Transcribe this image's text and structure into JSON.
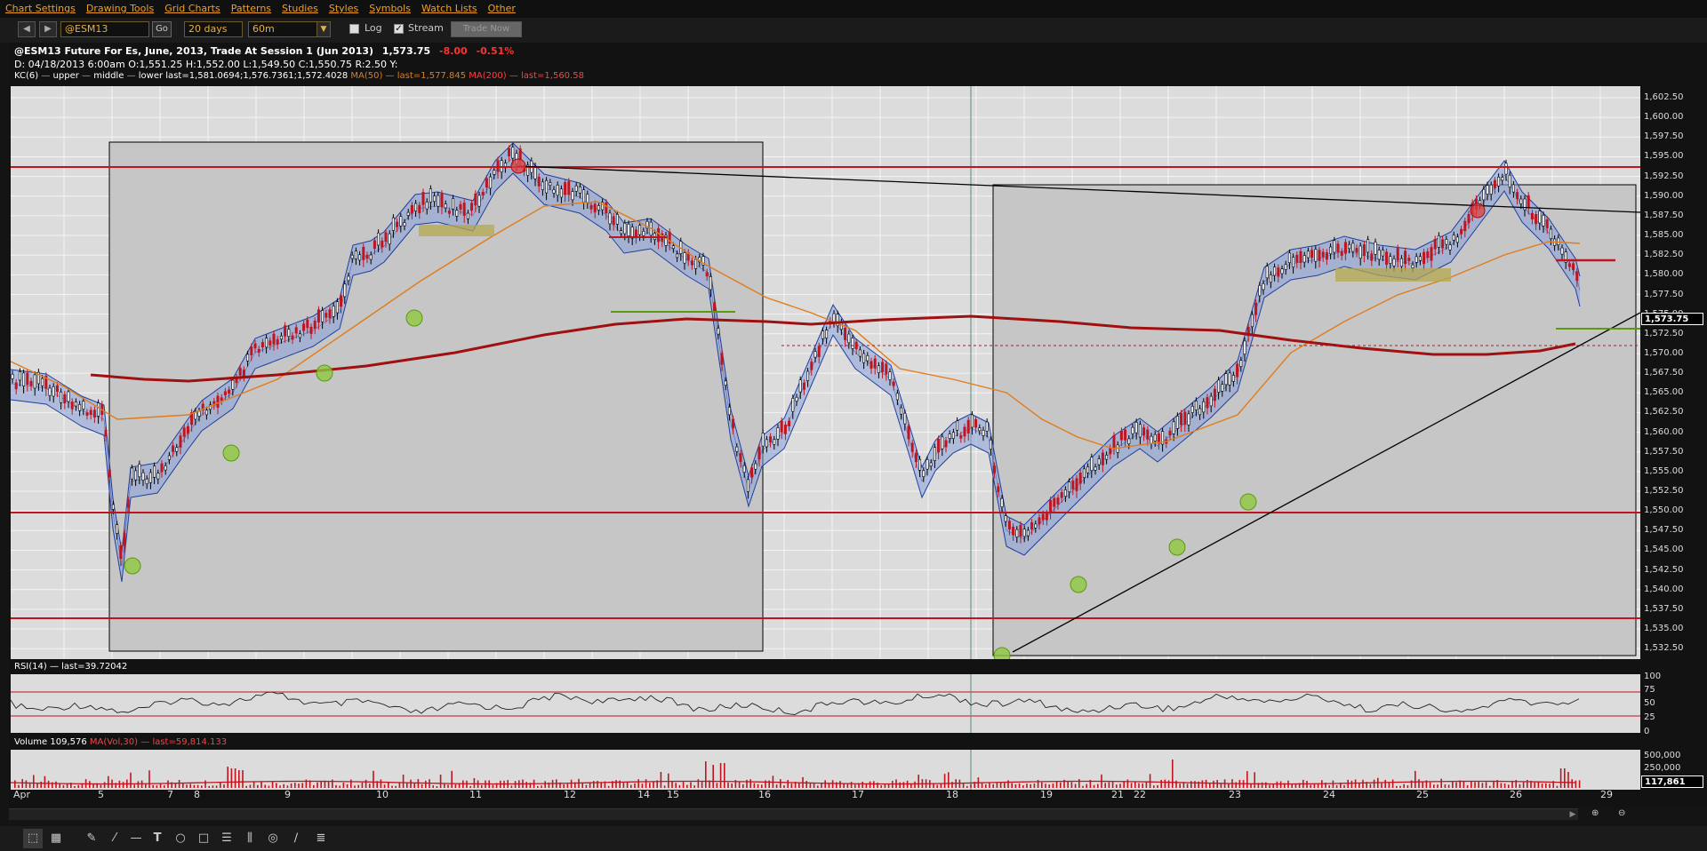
{
  "menu": [
    "Chart Settings",
    "Drawing Tools",
    "Grid Charts",
    "Patterns",
    "Studies",
    "Styles",
    "Symbols",
    "Watch Lists",
    "Other"
  ],
  "toolbar": {
    "back_glyph": "◀",
    "forward_glyph": "▶",
    "symbol": "@ESM13",
    "go": "Go",
    "period": "20 days",
    "interval": "60m",
    "log_label": "Log",
    "log_checked": false,
    "stream_label": "Stream",
    "stream_checked": true,
    "trade_now": "Trade Now"
  },
  "header": {
    "title": "@ESM13 Future For Es, June, 2013, Trade At Session 1 (Jun 2013)",
    "last": "1,573.75",
    "change": "-8.00",
    "change_pct": "-0.51%",
    "ohlc": "D: 04/18/2013    6:00am O:1,551.25 H:1,552.00 L:1,549.50 C:1,550.75 R:2.50   Y:",
    "kc_label": "KC(6)",
    "kc_upper": "upper",
    "kc_middle": "middle",
    "kc_lower": "lower",
    "kc_last": "last=1,581.0694;1,576.7361;1,572.4028",
    "ma50_label": "MA(50)",
    "ma50_last": "last=1,577.845",
    "ma200_label": "MA(200)",
    "ma200_last": "last=1,560.58"
  },
  "rsi": {
    "label": "RSI(14)",
    "last": "last=39.72042",
    "levels": [
      "100",
      "75",
      "50",
      "25",
      "0"
    ]
  },
  "volume": {
    "label": "Volume 109,576",
    "ma_label": "MA(Vol,30)",
    "ma_last": "last=59,814.133",
    "levels": [
      "500,000",
      "250,000"
    ],
    "current": "117,861"
  },
  "price_axis": [
    "1,602.50",
    "1,600.00",
    "1,597.50",
    "1,595.00",
    "1,592.50",
    "1,590.00",
    "1,587.50",
    "1,585.00",
    "1,582.50",
    "1,580.00",
    "1,577.50",
    "1,575.00",
    "1,572.50",
    "1,570.00",
    "1,567.50",
    "1,565.00",
    "1,562.50",
    "1,560.00",
    "1,557.50",
    "1,555.00",
    "1,552.50",
    "1,550.00",
    "1,547.50",
    "1,545.00",
    "1,542.50",
    "1,540.00",
    "1,537.50",
    "1,535.00",
    "1,532.50"
  ],
  "current_price": "1,573.75",
  "x_axis": [
    "Apr",
    "5",
    "7",
    "8",
    "9",
    "10",
    "11",
    "12",
    "14",
    "15",
    "16",
    "17",
    "18",
    "19",
    "21",
    "22",
    "23",
    "24",
    "25",
    "26",
    "29"
  ],
  "colors": {
    "accent": "#f0a020",
    "up": "#000000",
    "down": "#c0141e",
    "kc_fill": "#8aa0d8",
    "ma50": "#e07c1a",
    "ma200": "#a01010",
    "pane": "#dcdcdc"
  },
  "tools": [
    "pointer-icon",
    "grid-icon",
    "pencil-icon",
    "line-icon",
    "hline-icon",
    "text-icon",
    "ellipse-icon",
    "rect-icon",
    "fib-icon",
    "bars-icon",
    "pitchfork-icon",
    "brush-icon",
    "list-icon"
  ]
}
